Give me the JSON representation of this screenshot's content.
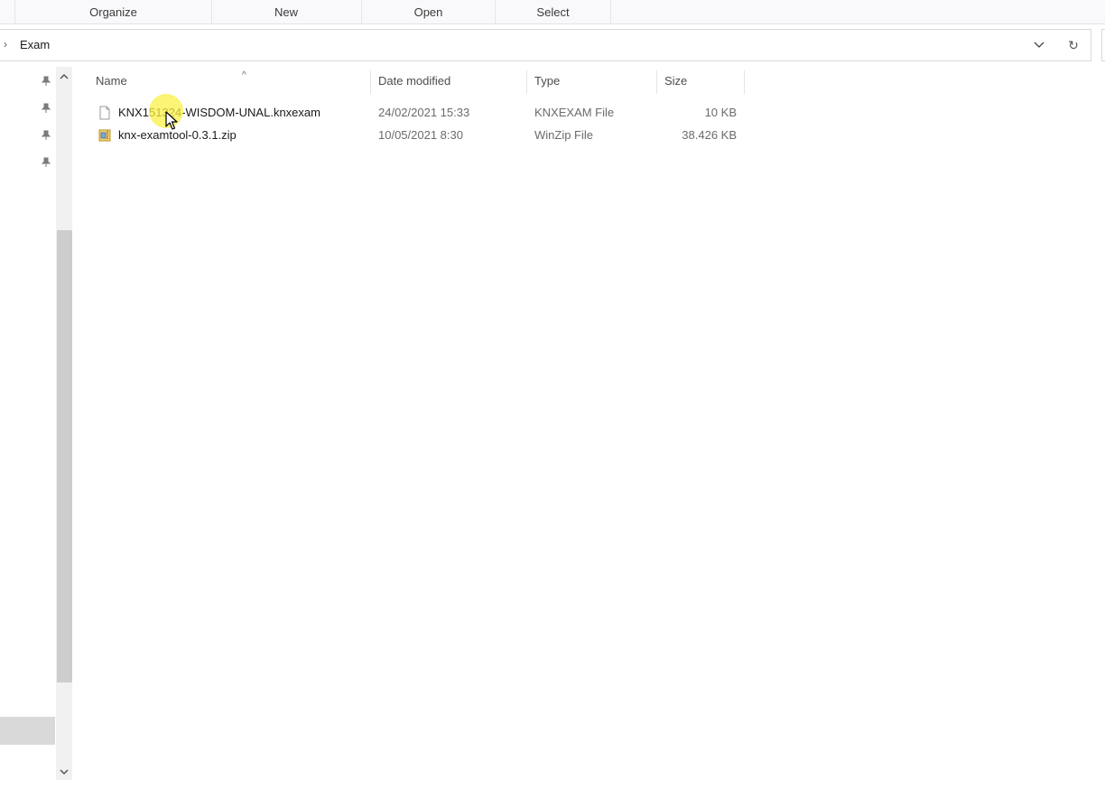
{
  "ribbon": {
    "groups": [
      "Organize",
      "New",
      "Open",
      "Select"
    ]
  },
  "address": {
    "chevron_icon": "chevron-right-icon",
    "path": "Exam",
    "dropdown_icon": "chevron-down-icon",
    "refresh_icon": "refresh-icon"
  },
  "nav": {
    "pins": [
      "pin-icon",
      "pin-icon",
      "pin-icon",
      "pin-icon"
    ]
  },
  "list": {
    "columns": {
      "name": "Name",
      "date": "Date modified",
      "type": "Type",
      "size": "Size"
    },
    "sort_icon": "sort-ascending-icon",
    "files": [
      {
        "name": "KNX151324-WISDOM-UNAL.knxexam",
        "date": "24/02/2021 15:33",
        "type": "KNXEXAM File",
        "size": "10 KB",
        "icon": "generic-file-icon"
      },
      {
        "name": "knx-examtool-0.3.1.zip",
        "date": "10/05/2021 8:30",
        "type": "WinZip File",
        "size": "38.426 KB",
        "icon": "zip-archive-icon"
      }
    ]
  },
  "colors": {
    "highlight": "#faf046",
    "scroll_thumb": "#cdcdcd",
    "nav_selected": "#d9d9d9"
  }
}
